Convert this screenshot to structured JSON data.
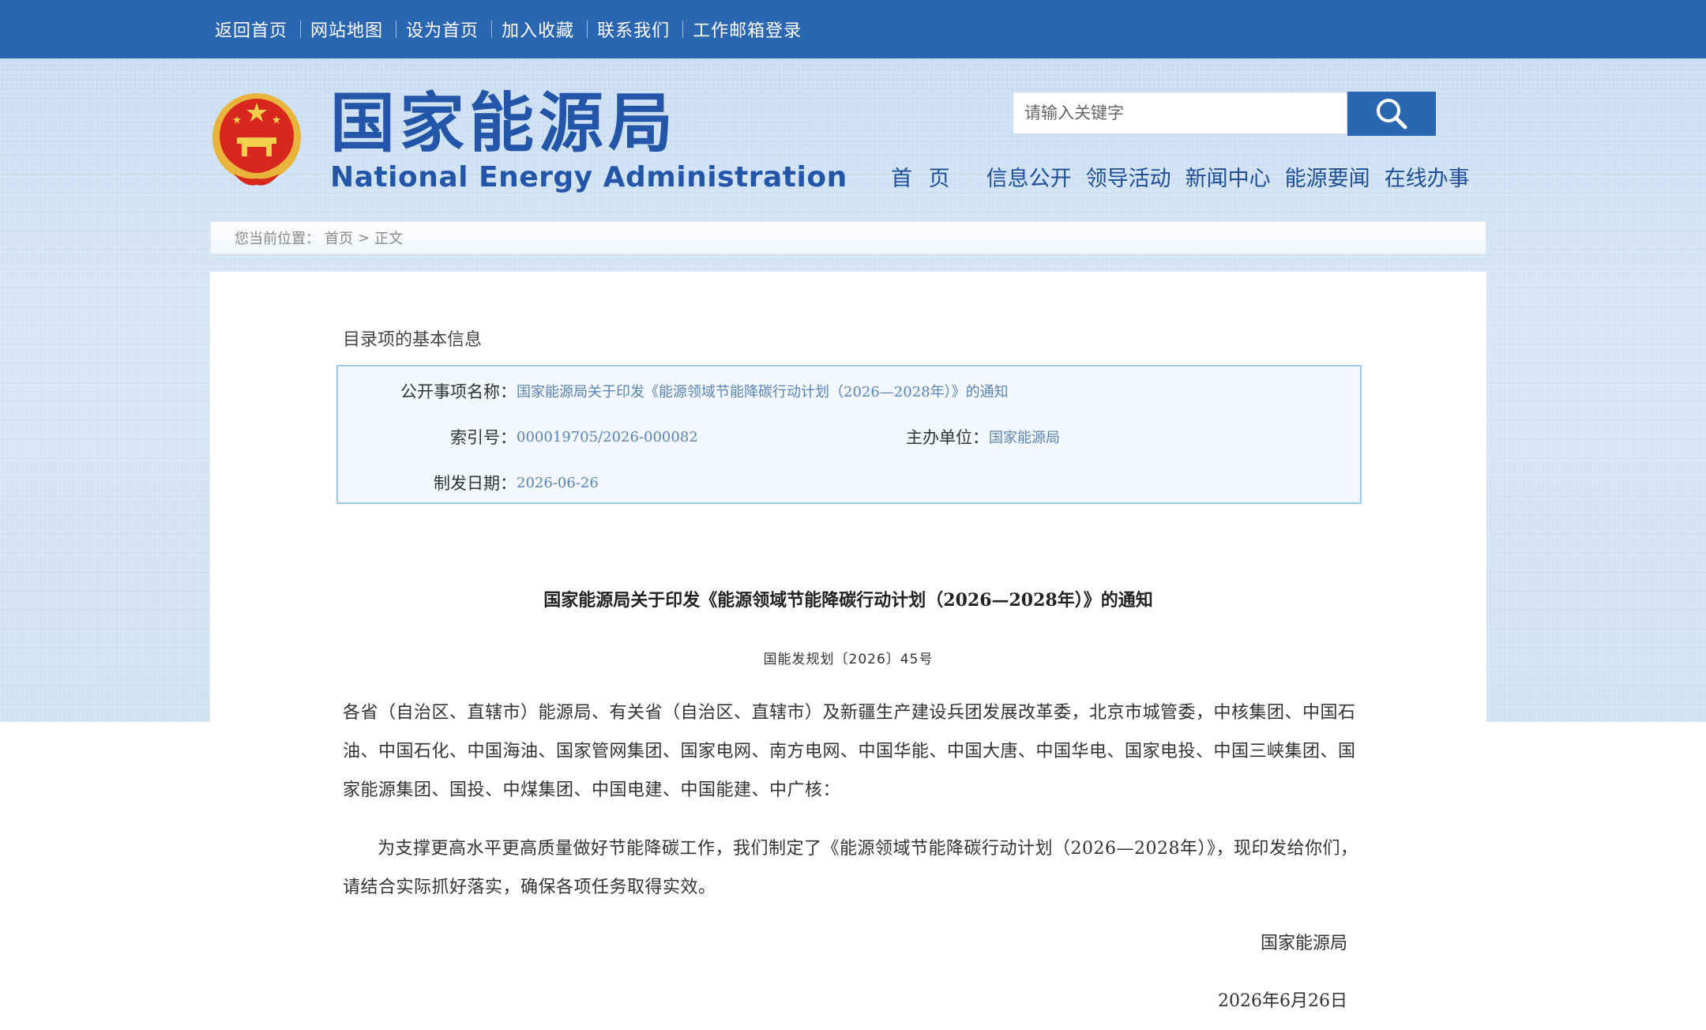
{
  "topbar": {
    "links": [
      "返回首页",
      "网站地图",
      "设为首页",
      "加入收藏",
      "联系我们",
      "工作邮箱登录"
    ]
  },
  "header": {
    "title_cn": "国家能源局",
    "title_en": "National Energy Administration",
    "search_placeholder": "请输入关键字",
    "nav": [
      "首 页",
      "信息公开",
      "领导活动",
      "新闻中心",
      "能源要闻",
      "在线办事"
    ]
  },
  "breadcrumb": {
    "prefix": "您当前位置：",
    "home": "首页",
    "sep": ">",
    "current": "正文"
  },
  "catalog": {
    "heading": "目录项的基本信息",
    "name_label": "公开事项名称：",
    "name_value": "国家能源局关于印发《能源领域节能降碳行动计划（2026—2028年）》的通知",
    "index_label": "索引号：",
    "index_value": "000019705/2026-000082",
    "org_label": "主办单位：",
    "org_value": "国家能源局",
    "date_label": "制发日期：",
    "date_value": "2026-06-26"
  },
  "document": {
    "title": "国家能源局关于印发《能源领域节能降碳行动计划（2026—2028年）》的通知",
    "number": "国能发规划〔2026〕45号",
    "recipients": "各省（自治区、直辖市）能源局、有关省（自治区、直辖市）及新疆生产建设兵团发展改革委，北京市城管委，中核集团、中国石油、中国石化、中国海油、国家管网集团、国家电网、南方电网、中国华能、中国大唐、中国华电、国家电投、中国三峡集团、国家能源集团、国投、中煤集团、中国电建、中国能建、中广核：",
    "body": "为支撑更高水平更高质量做好节能降碳工作，我们制定了《能源领域节能降碳行动计划（2026—2028年）》，现印发给你们，请结合实际抓好落实，确保各项任务取得实效。",
    "signature": "国家能源局",
    "date": "2026年6月26日"
  },
  "colors": {
    "topbar": "#2b66b3",
    "brand_blue": "#2356a8",
    "value_link": "#5a84b5",
    "info_border": "#9ccbe9"
  }
}
